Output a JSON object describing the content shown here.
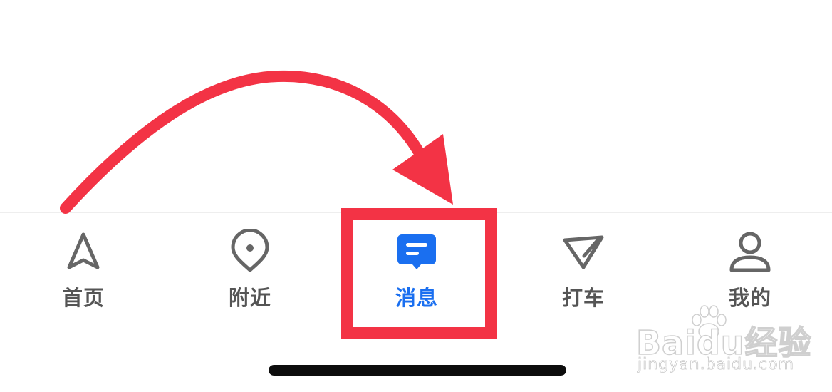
{
  "tabbar": {
    "tabs": [
      {
        "id": "home",
        "label": "首页",
        "icon": "navigation-arrow-icon",
        "active": false
      },
      {
        "id": "nearby",
        "label": "附近",
        "icon": "location-pin-icon",
        "active": false
      },
      {
        "id": "messages",
        "label": "消息",
        "icon": "chat-bubble-icon",
        "active": true
      },
      {
        "id": "taxi",
        "label": "打车",
        "icon": "taxi-triangle-icon",
        "active": false
      },
      {
        "id": "mine",
        "label": "我的",
        "icon": "user-icon",
        "active": false
      }
    ]
  },
  "colors": {
    "icon_inactive": "#666666",
    "label_inactive": "#555555",
    "active": "#1a6ff0",
    "annotation": "#f33345",
    "home_indicator": "#0d0d0d"
  },
  "watermark": {
    "brand": "Baidu经验",
    "url": "jingyan.baidu.com"
  }
}
